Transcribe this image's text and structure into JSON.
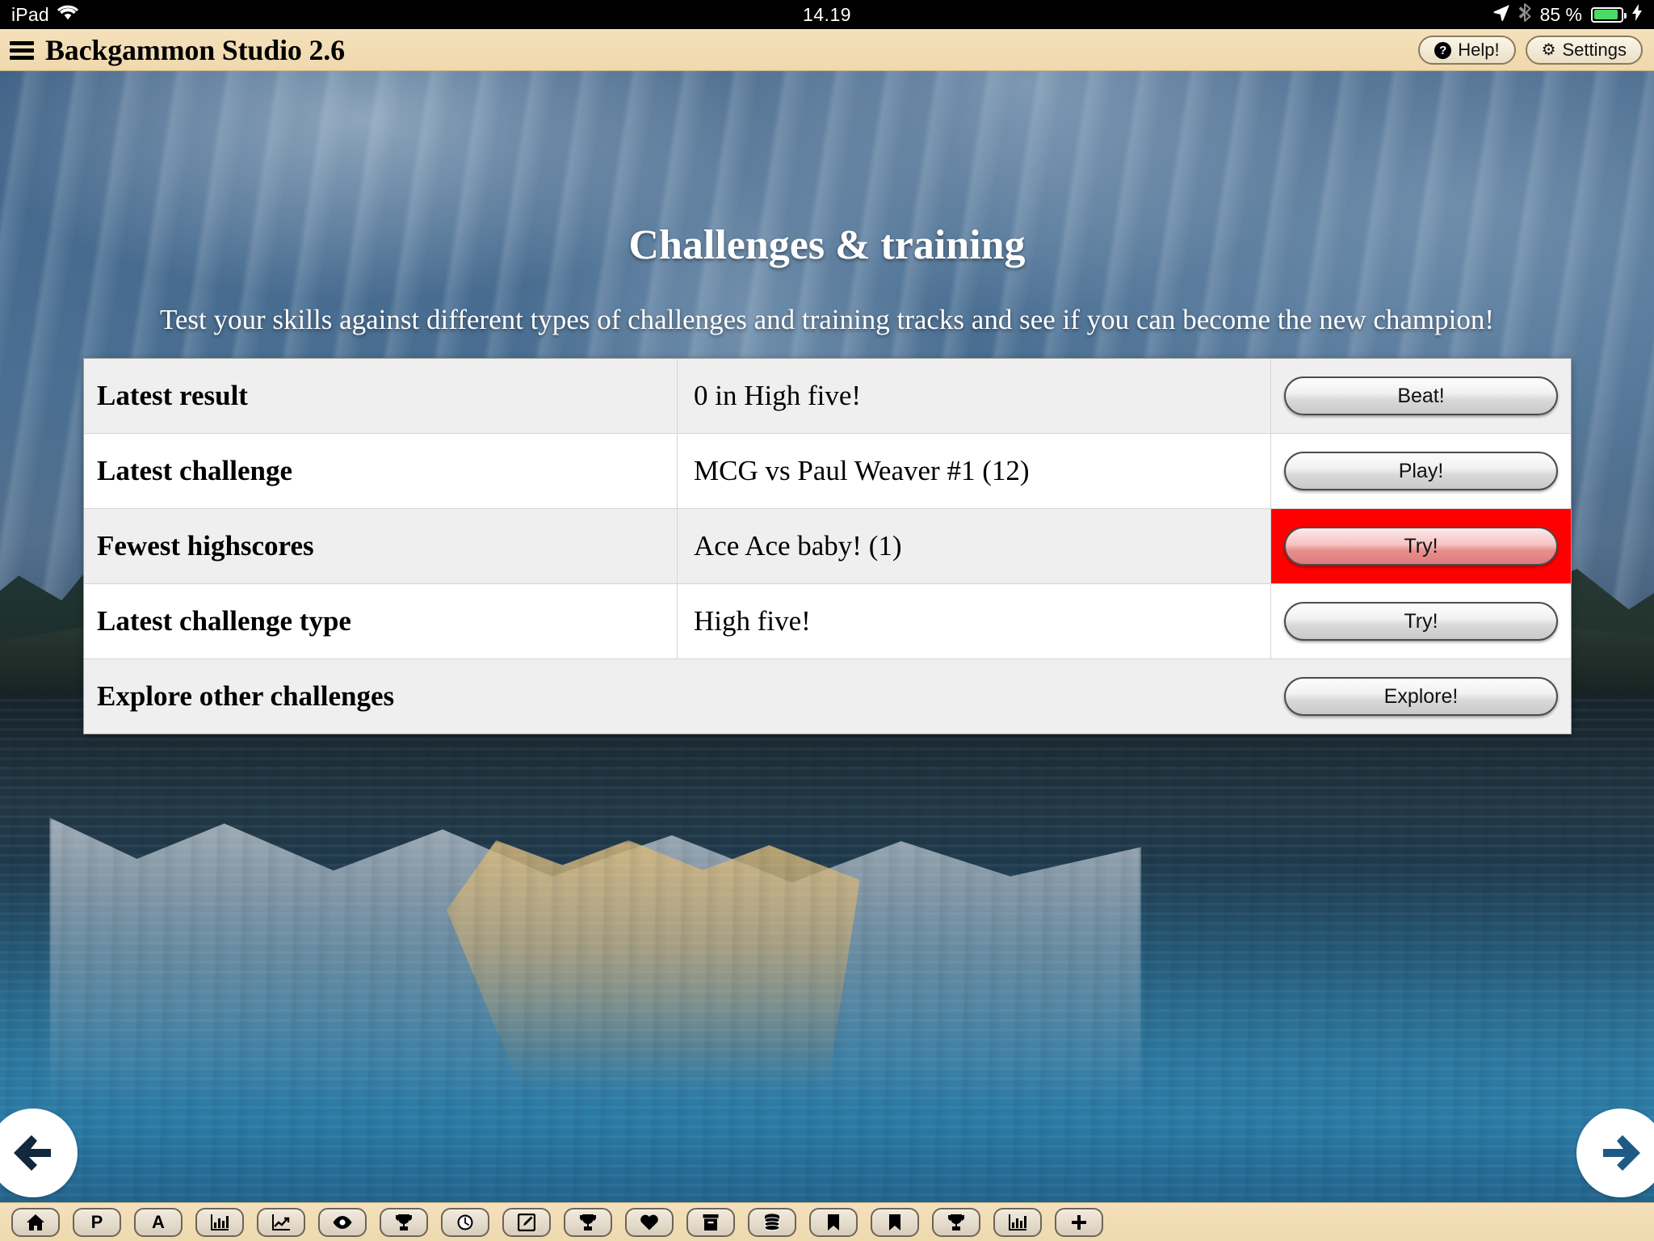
{
  "status_bar": {
    "device": "iPad",
    "wifi_icon": "wifi-icon",
    "time": "14.19",
    "location_icon": "location-arrow-icon",
    "bluetooth_icon": "bluetooth-icon",
    "battery_percent": "85 %",
    "charging_icon": "lightning-bolt-icon"
  },
  "app_bar": {
    "menu_icon": "hamburger-menu-icon",
    "title": "Backgammon Studio 2.6",
    "help_label": "Help!",
    "help_icon": "question-circle-icon",
    "settings_label": "Settings",
    "settings_icon": "gear-icon"
  },
  "page": {
    "title": "Challenges & training",
    "subtitle": "Test your skills against different types of challenges and training tracks and see if you can become the new champion!"
  },
  "table": {
    "rows": [
      {
        "label": "Latest result",
        "value": "0 in High five!",
        "action": "Beat!",
        "highlight": false,
        "shade": "alt"
      },
      {
        "label": "Latest challenge",
        "value": "MCG vs Paul Weaver #1 (12)",
        "action": "Play!",
        "highlight": false,
        "shade": "plain"
      },
      {
        "label": "Fewest highscores",
        "value": "Ace Ace baby! (1)",
        "action": "Try!",
        "highlight": true,
        "shade": "alt"
      },
      {
        "label": "Latest challenge type",
        "value": "High five!",
        "action": "Try!",
        "highlight": false,
        "shade": "plain"
      },
      {
        "label": "Explore other challenges",
        "value": "",
        "action": "Explore!",
        "highlight": false,
        "shade": "alt"
      }
    ]
  },
  "navigation": {
    "prev_icon": "arrow-left-circle-icon",
    "next_icon": "arrow-right-circle-icon"
  },
  "toolbar": {
    "items": [
      {
        "icon": "home-icon",
        "letter": ""
      },
      {
        "icon": "letter-p-icon",
        "letter": "P"
      },
      {
        "icon": "letter-a-icon",
        "letter": "A"
      },
      {
        "icon": "bar-chart-icon",
        "letter": ""
      },
      {
        "icon": "line-chart-icon",
        "letter": ""
      },
      {
        "icon": "eye-icon",
        "letter": ""
      },
      {
        "icon": "trophy-icon",
        "letter": ""
      },
      {
        "icon": "clock-icon",
        "letter": ""
      },
      {
        "icon": "edit-square-icon",
        "letter": ""
      },
      {
        "icon": "trophy-icon",
        "letter": ""
      },
      {
        "icon": "heart-icon",
        "letter": ""
      },
      {
        "icon": "archive-box-icon",
        "letter": ""
      },
      {
        "icon": "database-icon",
        "letter": ""
      },
      {
        "icon": "bookmark-icon",
        "letter": ""
      },
      {
        "icon": "bookmark-icon",
        "letter": ""
      },
      {
        "icon": "trophy-icon",
        "letter": ""
      },
      {
        "icon": "bar-chart-icon",
        "letter": ""
      },
      {
        "icon": "plus-icon",
        "letter": ""
      }
    ]
  },
  "colors": {
    "app_bar": "#f2ddb3",
    "highlight": "#ff0000",
    "battery": "#4cd964",
    "row_alt": "#efefef"
  }
}
